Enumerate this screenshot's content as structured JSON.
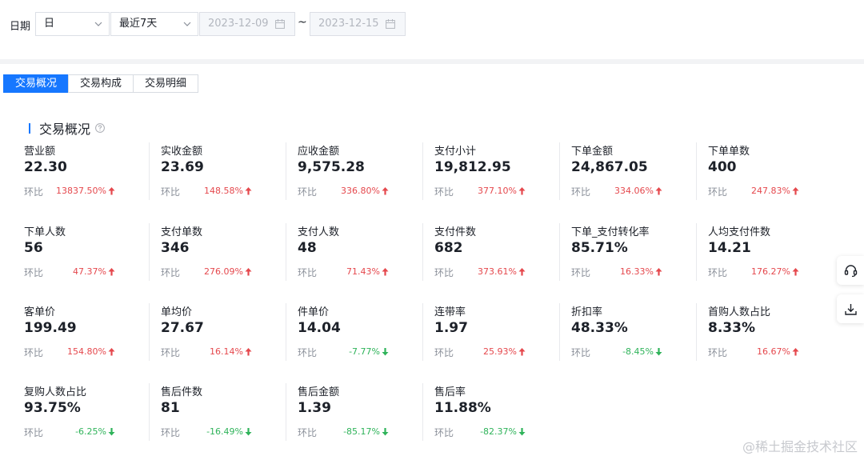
{
  "filter": {
    "label": "日期",
    "granularity": "日",
    "range": "最近7天",
    "start_date": "2023-12-09",
    "end_date": "2023-12-15",
    "separator": "~"
  },
  "tabs": [
    {
      "label": "交易概况",
      "active": true
    },
    {
      "label": "交易构成",
      "active": false
    },
    {
      "label": "交易明细",
      "active": false
    }
  ],
  "section": {
    "title": "交易概况"
  },
  "compare_label": "环比",
  "metrics": [
    [
      {
        "label": "营业额",
        "value": "22.30",
        "change": "13837.50%",
        "dir": "up"
      },
      {
        "label": "实收金额",
        "value": "23.69",
        "change": "148.58%",
        "dir": "up"
      },
      {
        "label": "应收金额",
        "value": "9,575.28",
        "change": "336.80%",
        "dir": "up"
      },
      {
        "label": "支付小计",
        "value": "19,812.95",
        "change": "377.10%",
        "dir": "up"
      },
      {
        "label": "下单金额",
        "value": "24,867.05",
        "change": "334.06%",
        "dir": "up"
      },
      {
        "label": "下单单数",
        "value": "400",
        "change": "247.83%",
        "dir": "up"
      }
    ],
    [
      {
        "label": "下单人数",
        "value": "56",
        "change": "47.37%",
        "dir": "up"
      },
      {
        "label": "支付单数",
        "value": "346",
        "change": "276.09%",
        "dir": "up"
      },
      {
        "label": "支付人数",
        "value": "48",
        "change": "71.43%",
        "dir": "up"
      },
      {
        "label": "支付件数",
        "value": "682",
        "change": "373.61%",
        "dir": "up"
      },
      {
        "label": "下单_支付转化率",
        "value": "85.71%",
        "change": "16.33%",
        "dir": "up"
      },
      {
        "label": "人均支付件数",
        "value": "14.21",
        "change": "176.27%",
        "dir": "up"
      }
    ],
    [
      {
        "label": "客单价",
        "value": "199.49",
        "change": "154.80%",
        "dir": "up"
      },
      {
        "label": "单均价",
        "value": "27.67",
        "change": "16.14%",
        "dir": "up"
      },
      {
        "label": "件单价",
        "value": "14.04",
        "change": "-7.77%",
        "dir": "down"
      },
      {
        "label": "连带率",
        "value": "1.97",
        "change": "25.93%",
        "dir": "up"
      },
      {
        "label": "折扣率",
        "value": "48.33%",
        "change": "-8.45%",
        "dir": "down"
      },
      {
        "label": "首购人数占比",
        "value": "8.33%",
        "change": "16.67%",
        "dir": "up"
      }
    ],
    [
      {
        "label": "复购人数占比",
        "value": "93.75%",
        "change": "-6.25%",
        "dir": "down"
      },
      {
        "label": "售后件数",
        "value": "81",
        "change": "-16.49%",
        "dir": "down"
      },
      {
        "label": "售后金额",
        "value": "1.39",
        "change": "-85.17%",
        "dir": "down"
      },
      {
        "label": "售后率",
        "value": "11.88%",
        "change": "-82.37%",
        "dir": "down"
      }
    ]
  ],
  "colors": {
    "accent": "#1677ff",
    "up": "#e5484d",
    "down": "#2fb35a"
  },
  "side_buttons": [
    {
      "icon": "headset-icon"
    },
    {
      "icon": "download-icon"
    }
  ],
  "watermark": "@稀土掘金技术社区"
}
